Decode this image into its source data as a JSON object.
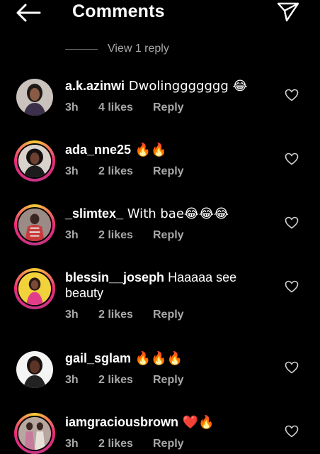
{
  "header": {
    "title": "Comments",
    "back_icon": "arrow-left-icon",
    "send_icon": "paper-plane-icon"
  },
  "thread": {
    "view_replies_label": "View 1 reply"
  },
  "colors": {
    "background": "#000000",
    "text": "#ffffff",
    "secondary": "#a8a8a8",
    "story_ring": [
      "#f9ce34",
      "#ee2a7b",
      "#c13584"
    ]
  },
  "comments": [
    {
      "username": "a.k.azinwi",
      "text": " Dwolinggggggg 😂",
      "time": "3h",
      "likes": "4 likes",
      "reply_label": "Reply",
      "story_ring": false
    },
    {
      "username": "ada_nne25",
      "text": " 🔥🔥",
      "time": "3h",
      "likes": "2 likes",
      "reply_label": "Reply",
      "story_ring": true
    },
    {
      "username": "_slimtex_",
      "text": " With bae😂😂😂",
      "time": "3h",
      "likes": "2 likes",
      "reply_label": "Reply",
      "story_ring": true
    },
    {
      "username": "blessin__joseph",
      "text": " Haaaaa see beauty",
      "time": "3h",
      "likes": "2 likes",
      "reply_label": "Reply",
      "story_ring": true
    },
    {
      "username": "gail_sglam",
      "text": " 🔥🔥🔥",
      "time": "3h",
      "likes": "2 likes",
      "reply_label": "Reply",
      "story_ring": false
    },
    {
      "username": "iamgraciousbrown",
      "text": " ❤️🔥",
      "time": "3h",
      "likes": "2 likes",
      "reply_label": "Reply",
      "story_ring": true
    }
  ]
}
